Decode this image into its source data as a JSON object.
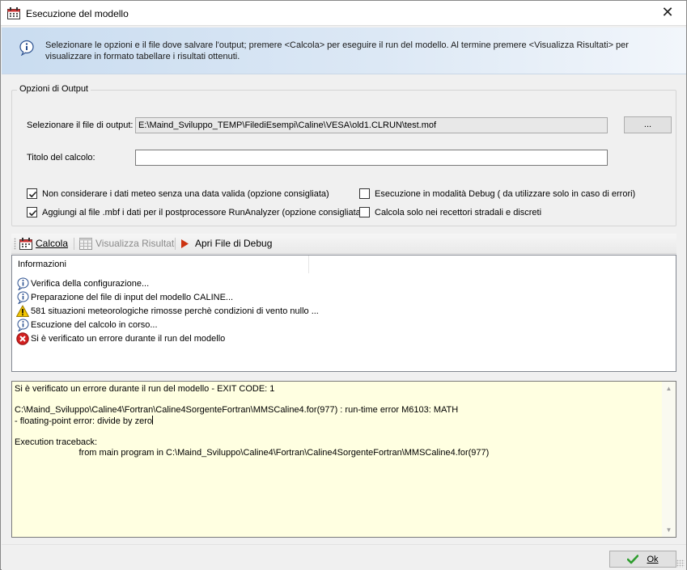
{
  "window": {
    "title": "Esecuzione del modello",
    "close_glyph": "✕"
  },
  "banner": {
    "text": "Selezionare le opzioni e il file dove salvare l'output; premere <Calcola> per eseguire il run del modello. Al termine premere <Visualizza Risultati> per visualizzare in formato tabellare i risultati ottenuti."
  },
  "output_options": {
    "legend": "Opzioni di Output",
    "file_label": "Selezionare il file di output:",
    "file_value": "E:\\Maind_Sviluppo_TEMP\\FilediEsempi\\Caline\\VESA\\old1.CLRUN\\test.mof",
    "browse_label": "...",
    "title_label": "Titolo del calcolo:",
    "title_value": "",
    "checkboxes": [
      {
        "label": "Non considerare i dati meteo senza una data valida (opzione consigliata)",
        "checked": true
      },
      {
        "label": "Aggiungi al file .mbf i dati per il postprocessore RunAnalyzer (opzione consigliata)",
        "checked": true
      },
      {
        "label": "Esecuzione in modalità Debug ( da utilizzare solo in caso di errori)",
        "checked": false
      },
      {
        "label": "Calcola solo nei recettori stradali e discreti",
        "checked": false
      }
    ]
  },
  "toolbar": {
    "calcola": "Calcola",
    "visualizza": "Visualizza Risultati",
    "apri_debug": "Apri File di Debug"
  },
  "log": {
    "column": "Informazioni",
    "rows": [
      {
        "icon": "info-icon",
        "text": "Verifica della configurazione..."
      },
      {
        "icon": "info-icon",
        "text": "Preparazione del file di input del modello CALINE..."
      },
      {
        "icon": "warning-icon",
        "text": "581 situazioni meteorologiche rimosse perchè condizioni di vento nullo ..."
      },
      {
        "icon": "info-icon",
        "text": "Escuzione del calcolo in corso..."
      },
      {
        "icon": "error-icon",
        "text": "Si è verificato un errore durante il run del modello"
      }
    ]
  },
  "output_text": "Si è verificato un errore durante il run del modello - EXIT CODE: 1\n\nC:\\Maind_Sviluppo\\Caline4\\Fortran\\Caline4SorgenteFortran\\MMSCaline4.for(977) : run-time error M6103: MATH\n- floating-point error: divide by zero",
  "output_text2": "\n\nExecution traceback:\n                          from main program in C:\\Maind_Sviluppo\\Caline4\\Fortran\\Caline4SorgenteFortran\\MMSCaline4.for(977)",
  "footer": {
    "ok_label": "Ok"
  },
  "colors": {
    "output_bg": "#ffffe1",
    "error_red": "#d32020",
    "warning_yellow": "#f2c500",
    "ok_green": "#2e9d2e",
    "debug_red": "#cc3311"
  }
}
